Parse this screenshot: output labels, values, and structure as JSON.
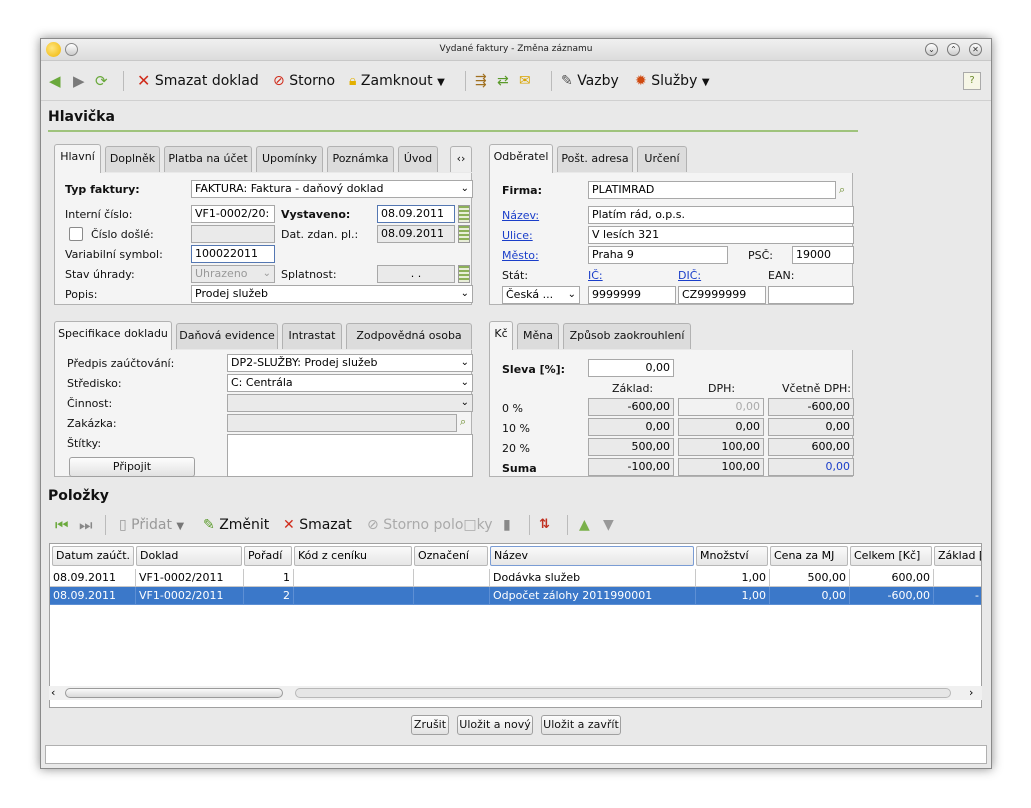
{
  "window": {
    "title": "Vydané faktury - Změna záznamu"
  },
  "toolbar": {
    "delete_label": "Smazat doklad",
    "storno_label": "Storno",
    "lock_label": "Zamknout",
    "links_label": "Vazby",
    "services_label": "Služby"
  },
  "header": {
    "title": "Hlavička"
  },
  "left_tabs": [
    "Hlavní",
    "Doplněk",
    "Platba na účet",
    "Upomínky",
    "Poznámka",
    "Úvod"
  ],
  "main": {
    "typ_faktury_label": "Typ faktury:",
    "typ_faktury_value": "FAKTURA: Faktura - daňový doklad",
    "interni_cislo_label": "Interní číslo:",
    "interni_cislo_value": "VF1-0002/20:",
    "vystaveno_label": "Vystaveno:",
    "vystaveno_value": "08.09.2011",
    "cislo_dosle_label": "Číslo došlé:",
    "dat_zdan_label": "Dat. zdan. pl.:",
    "dat_zdan_value": "08.09.2011",
    "var_symbol_label": "Variabilní symbol:",
    "var_symbol_value": "100022011",
    "stav_uhrady_label": "Stav úhrady:",
    "stav_uhrady_value": "Uhrazeno",
    "splatnost_label": "Splatnost:",
    "splatnost_value": ". .",
    "popis_label": "Popis:",
    "popis_value": "Prodej služeb"
  },
  "right_tabs": [
    "Odběratel",
    "Pošt. adresa",
    "Určení"
  ],
  "customer": {
    "firma_label": "Firma:",
    "firma_value": "PLATIMRAD",
    "nazev_label": "Název:",
    "nazev_value": "Platím rád, o.p.s.",
    "ulice_label": "Ulice:",
    "ulice_value": "V lesích 321",
    "mesto_label": "Město:",
    "mesto_value": "Praha 9",
    "psc_label": "PSČ:",
    "psc_value": "19000",
    "stat_label": "Stát:",
    "stat_value": "Česká ...",
    "ic_label": "IČ:",
    "ic_value": "9999999",
    "dic_label": "DIČ:",
    "dic_value": "CZ9999999",
    "ean_label": "EAN:",
    "ean_value": ""
  },
  "spec_tabs": [
    "Specifikace dokladu",
    "Daňová evidence",
    "Intrastat",
    "Zodpovědná osoba"
  ],
  "spec": {
    "predpis_label": "Předpis zaúčtování:",
    "predpis_value": "DP2-SLUŽBY: Prodej služeb",
    "stredisko_label": "Středisko:",
    "stredisko_value": "C: Centrála",
    "cinnost_label": "Činnost:",
    "zakazka_label": "Zakázka:",
    "stitky_label": "Štítky:",
    "pripojit_label": "Připojit"
  },
  "sum_tabs": [
    "Kč",
    "Měna",
    "Způsob zaokrouhlení"
  ],
  "sums": {
    "sleva_label": "Sleva [%]:",
    "sleva_value": "0,00",
    "col_zaklad": "Základ:",
    "col_dph": "DPH:",
    "col_vcetne": "Včetně DPH:",
    "rows": [
      {
        "label": "0 %",
        "zaklad": "-600,00",
        "dph": "0,00",
        "vcetne": "-600,00"
      },
      {
        "label": "10 %",
        "zaklad": "0,00",
        "dph": "0,00",
        "vcetne": "0,00"
      },
      {
        "label": "20 %",
        "zaklad": "500,00",
        "dph": "100,00",
        "vcetne": "600,00"
      },
      {
        "label": "Suma",
        "zaklad": "-100,00",
        "dph": "100,00",
        "vcetne": "0,00"
      }
    ]
  },
  "items": {
    "title": "Položky",
    "add_label": "Přidat",
    "edit_label": "Změnit",
    "delete_label": "Smazat",
    "storno_label": "Storno polo□ky",
    "columns": [
      "Datum zaúčt.",
      "Doklad",
      "Pořadí",
      "Kód z ceníku",
      "Označení",
      "Název",
      "Množství",
      "Cena za MJ",
      "Celkem [Kč]",
      "Základ ["
    ],
    "rows": [
      {
        "datum": "08.09.2011",
        "doklad": "VF1-0002/2011",
        "poradi": "1",
        "kod": "",
        "oznaceni": "",
        "nazev": "Dodávka služeb",
        "mnozstvi": "1,00",
        "cena": "500,00",
        "celkem": "600,00",
        "zaklad": ""
      },
      {
        "datum": "08.09.2011",
        "doklad": "VF1-0002/2011",
        "poradi": "2",
        "kod": "",
        "oznaceni": "",
        "nazev": "Odpočet zálohy 2011990001",
        "mnozstvi": "1,00",
        "cena": "0,00",
        "celkem": "-600,00",
        "zaklad": "-"
      }
    ]
  },
  "footer": {
    "cancel_label": "Zrušit",
    "save_new_label": "Uložit a nový",
    "save_close_label": "Uložit a zavřít"
  },
  "colors": {
    "accent_line": "#9fc37c",
    "selection": "#3b78c9",
    "link": "#1a3ec9",
    "delete_red": "#d02b1a"
  }
}
